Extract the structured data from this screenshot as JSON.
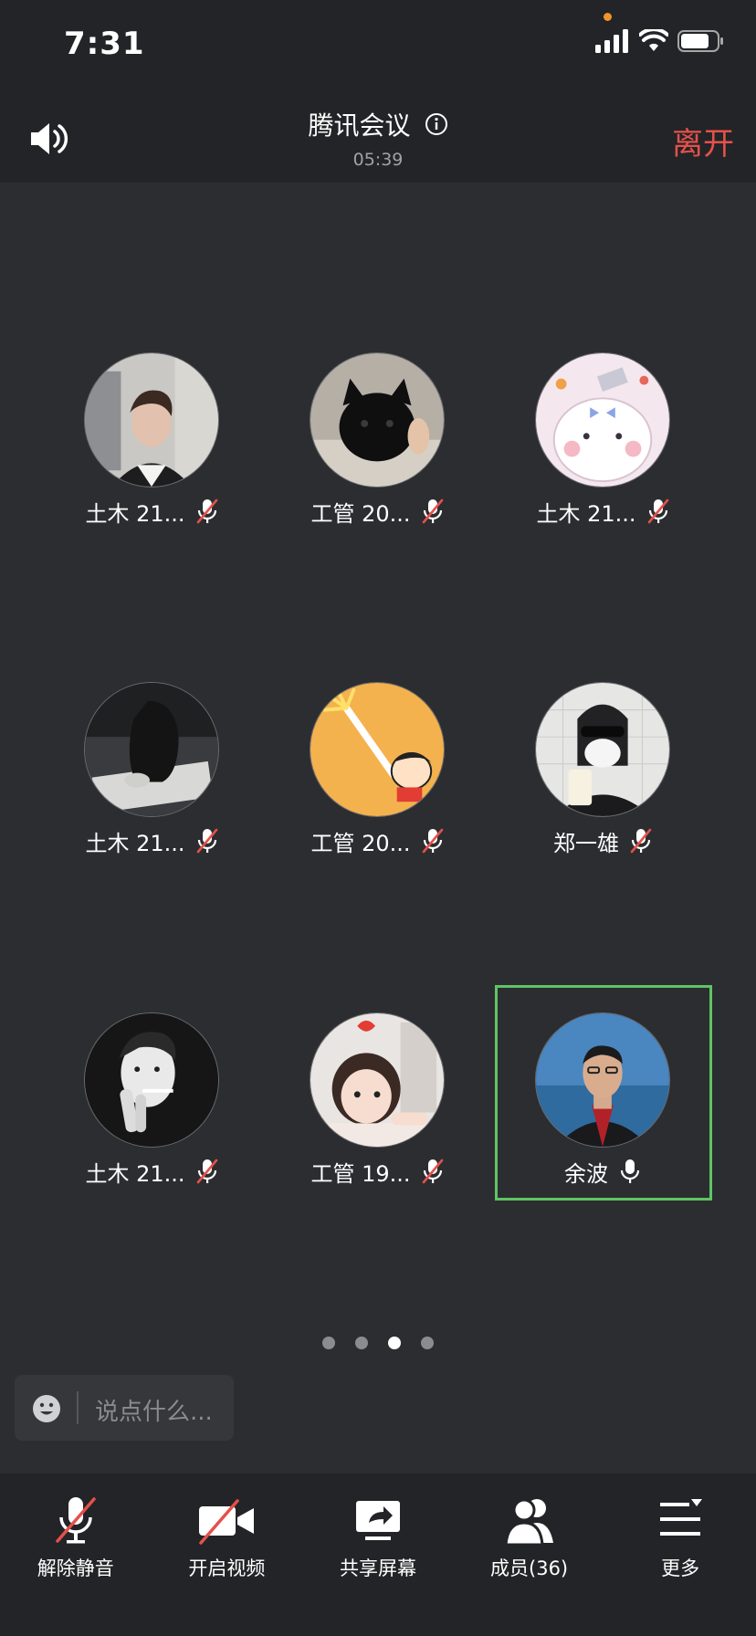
{
  "status": {
    "time": "7:31"
  },
  "header": {
    "title": "腾讯会议",
    "timer": "05:39",
    "leave_label": "离开"
  },
  "participants": [
    {
      "name": "土木 21...",
      "muted": true
    },
    {
      "name": "工管 20...",
      "muted": true
    },
    {
      "name": "土木 21...",
      "muted": true
    },
    {
      "name": "土木 21...",
      "muted": true
    },
    {
      "name": "工管 20...",
      "muted": true
    },
    {
      "name": "郑一雄",
      "muted": true
    },
    {
      "name": "土木 21...",
      "muted": true
    },
    {
      "name": "工管 19...",
      "muted": true
    },
    {
      "name": "余波",
      "muted": false,
      "active_speaker": true
    }
  ],
  "pagination": {
    "total": 4,
    "current": 3
  },
  "chat": {
    "placeholder": "说点什么..."
  },
  "toolbar": {
    "unmute_label": "解除静音",
    "video_label": "开启视频",
    "share_label": "共享屏幕",
    "members_label": "成员(36)",
    "more_label": "更多"
  },
  "colors": {
    "leave": "#e4514b",
    "active_outline": "#5fc464",
    "mute_slash": "#e4514b"
  }
}
